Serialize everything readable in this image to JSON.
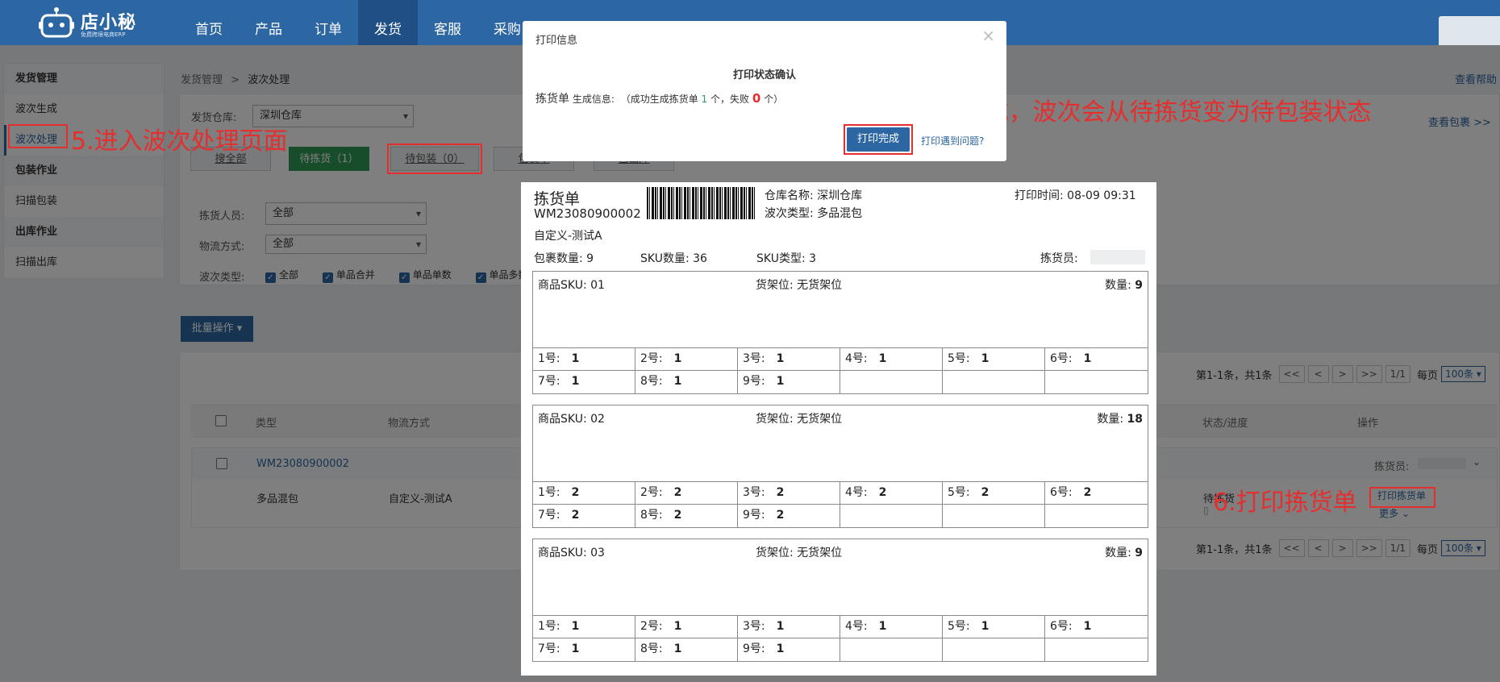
{
  "header": {
    "logo_text": "店小秘",
    "logo_sub": "免费跨境电商ERP",
    "nav": [
      "首页",
      "产品",
      "订单",
      "发货",
      "客服",
      "采购"
    ],
    "active_nav": "发货"
  },
  "sidebar": {
    "groups": [
      {
        "title": "发货管理",
        "items": [
          "波次生成",
          "波次处理"
        ]
      },
      {
        "title": "包装作业",
        "items": [
          "扫描包装"
        ]
      },
      {
        "title": "出库作业",
        "items": [
          "扫描出库"
        ]
      }
    ]
  },
  "breadcrumb": {
    "parent": "发货管理",
    "sep": ">",
    "current": "波次处理"
  },
  "help_link": "查看帮助",
  "view_pack_link": "查看包裹 >>",
  "filters": {
    "warehouse_label": "发货仓库:",
    "warehouse_value": "深圳仓库",
    "picker_label": "拣货人员:",
    "picker_value": "全部",
    "logistics_label": "物流方式:",
    "logistics_value": "全部",
    "wave_type_label": "波次类型:",
    "wave_types": [
      "全部",
      "单品合并",
      "单品单数",
      "单品多数"
    ]
  },
  "tabs": {
    "all": "搜全部",
    "pending_pick": "待拣货（1）",
    "pending_pack": "待包装（0）",
    "pack_partial": "包装中",
    "other": "已出库"
  },
  "batch_button": "批量操作",
  "pager": {
    "summary": "第1-1条，共1条",
    "first": "<<",
    "prev": "<",
    "next": ">",
    "last": ">>",
    "page": "1/1",
    "per_page_label": "每页",
    "per_page": "100条"
  },
  "table": {
    "headers": {
      "type": "类型",
      "logistics": "物流方式",
      "status": "状态/进度",
      "action": "操作"
    },
    "row": {
      "code": "WM23080900002",
      "type": "多品混包",
      "logistics": "自定义-测试A",
      "picker_label": "拣货员:",
      "status": "待拣货",
      "print_button": "打印拣货单",
      "more": "更多"
    }
  },
  "dialog": {
    "title": "打印信息",
    "close": "×",
    "subtitle": "打印状态确认",
    "msg_prefix": "拣货单",
    "msg_label": "生成信息:",
    "msg_body_a": "（成功生成拣货单",
    "success_count": "1",
    "msg_body_b": "个，失败",
    "fail_count": "0",
    "msg_body_c": "个）",
    "done_button": "打印完成",
    "problem_link": "打印遇到问题?"
  },
  "sheet": {
    "title": "拣货单",
    "code": "WM23080900002",
    "warehouse_label": "仓库名称:",
    "warehouse": "深圳仓库",
    "wave_type_label": "波次类型:",
    "wave_type": "多品混包",
    "print_time_label": "打印时间:",
    "print_time": "08-09 09:31",
    "logistics": "自定义-测试A",
    "pkg_count_label": "包裹数量:",
    "pkg_count": "9",
    "sku_count_label": "SKU数量:",
    "sku_count": "36",
    "sku_type_label": "SKU类型:",
    "sku_type": "3",
    "picker_label": "拣货员:",
    "blocks": [
      {
        "sku_label": "商品SKU:",
        "sku": "01",
        "shelf_label": "货架位:",
        "shelf": "无货架位",
        "qty_label": "数量:",
        "qty": "9",
        "slots": [
          [
            "1号:",
            "1"
          ],
          [
            "2号:",
            "1"
          ],
          [
            "3号:",
            "1"
          ],
          [
            "4号:",
            "1"
          ],
          [
            "5号:",
            "1"
          ],
          [
            "6号:",
            "1"
          ],
          [
            "7号:",
            "1"
          ],
          [
            "8号:",
            "1"
          ],
          [
            "9号:",
            "1"
          ],
          [
            "",
            ""
          ],
          [
            "",
            ""
          ],
          [
            "",
            ""
          ]
        ]
      },
      {
        "sku_label": "商品SKU:",
        "sku": "02",
        "shelf_label": "货架位:",
        "shelf": "无货架位",
        "qty_label": "数量:",
        "qty": "18",
        "slots": [
          [
            "1号:",
            "2"
          ],
          [
            "2号:",
            "2"
          ],
          [
            "3号:",
            "2"
          ],
          [
            "4号:",
            "2"
          ],
          [
            "5号:",
            "2"
          ],
          [
            "6号:",
            "2"
          ],
          [
            "7号:",
            "2"
          ],
          [
            "8号:",
            "2"
          ],
          [
            "9号:",
            "2"
          ],
          [
            "",
            ""
          ],
          [
            "",
            ""
          ],
          [
            "",
            ""
          ]
        ]
      },
      {
        "sku_label": "商品SKU:",
        "sku": "03",
        "shelf_label": "货架位:",
        "shelf": "无货架位",
        "qty_label": "数量:",
        "qty": "9",
        "slots": [
          [
            "1号:",
            "1"
          ],
          [
            "2号:",
            "1"
          ],
          [
            "3号:",
            "1"
          ],
          [
            "4号:",
            "1"
          ],
          [
            "5号:",
            "1"
          ],
          [
            "6号:",
            "1"
          ],
          [
            "7号:",
            "1"
          ],
          [
            "8号:",
            "1"
          ],
          [
            "9号:",
            "1"
          ],
          [
            "",
            ""
          ],
          [
            "",
            ""
          ],
          [
            "",
            ""
          ]
        ]
      }
    ]
  },
  "annotations": {
    "step5": "5.进入波次处理页面",
    "step6": "6.打印拣货单",
    "step7": "7.点击打印完成，波次会从待拣货变为待包装状态"
  },
  "colors": {
    "primary": "#2c66a3",
    "success": "#2f9a55",
    "annotation": "#e52e2e"
  }
}
